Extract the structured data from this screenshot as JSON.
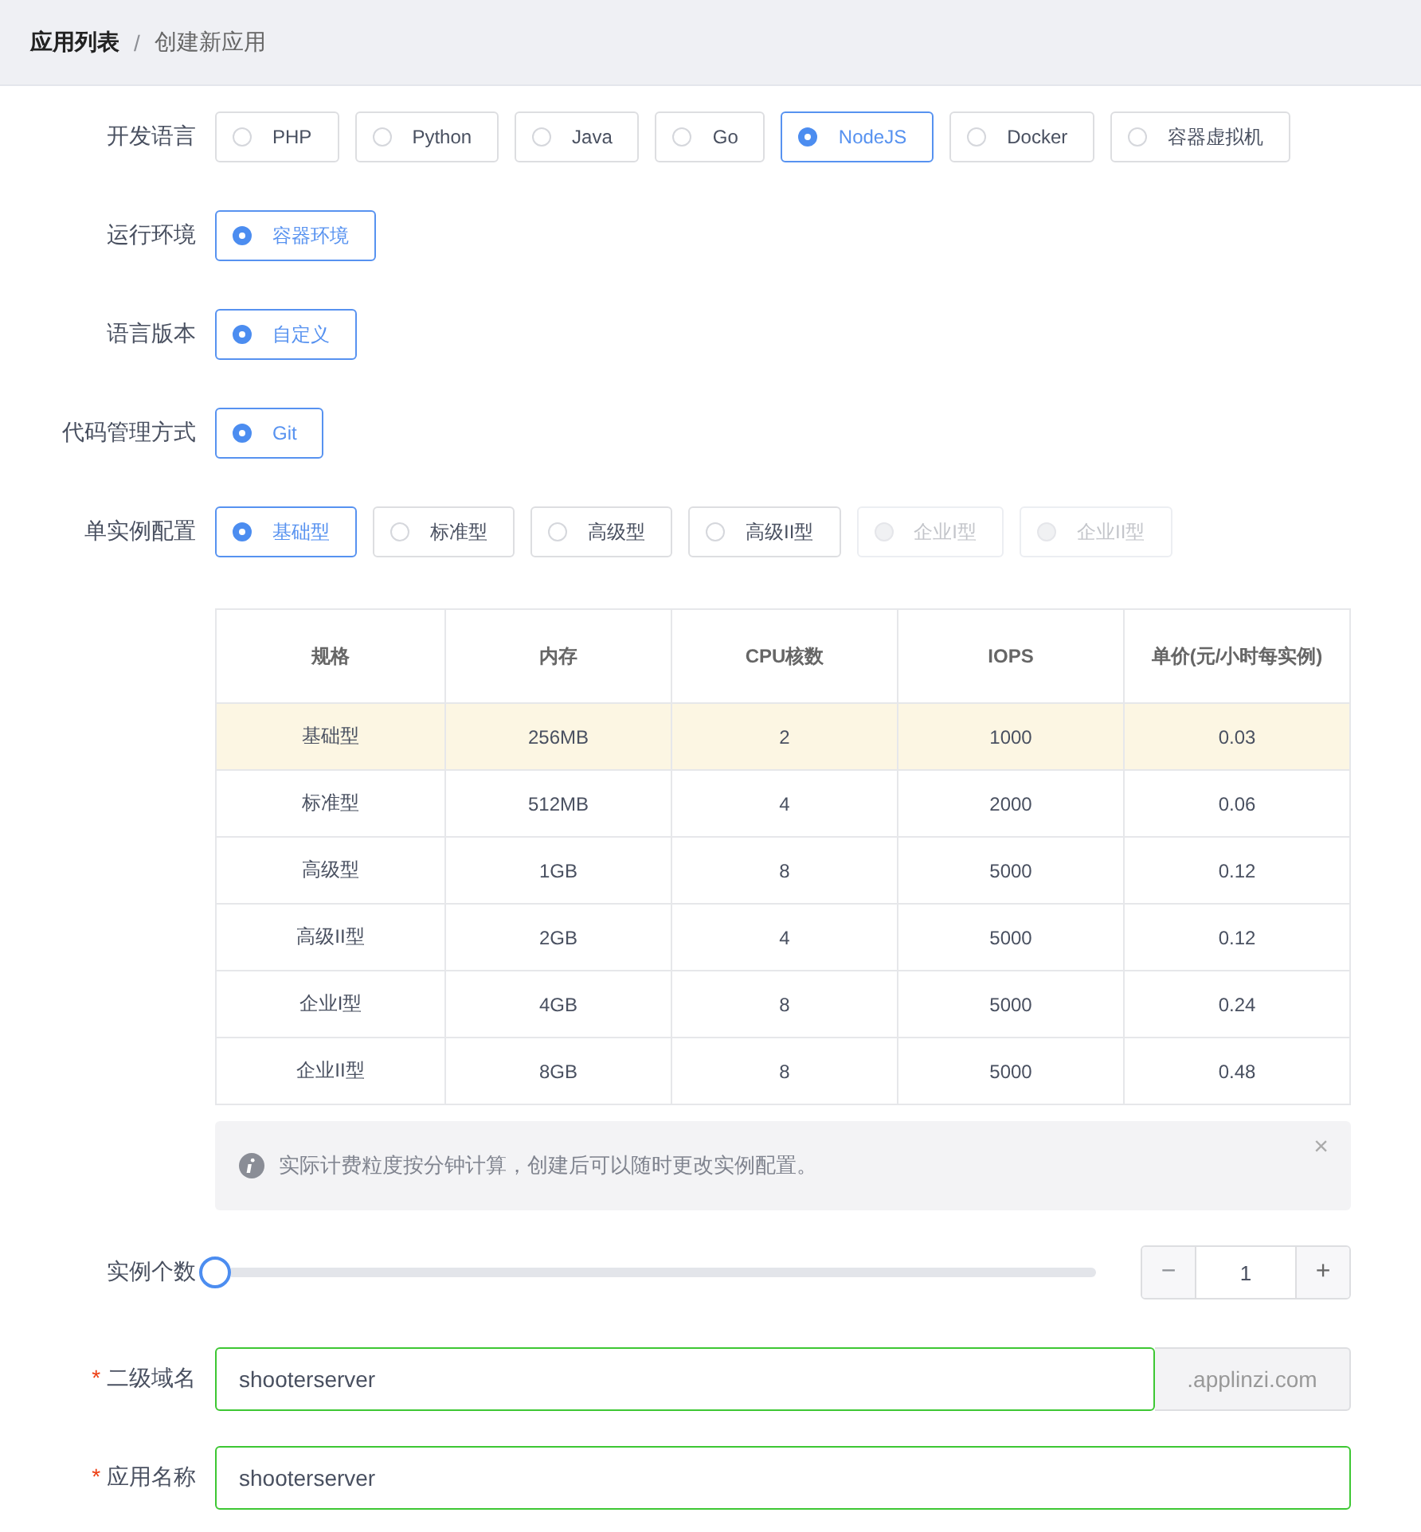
{
  "breadcrumb": [
    {
      "label": "应用列表",
      "current": false
    },
    {
      "label": "创建新应用",
      "current": true
    }
  ],
  "breadcrumb_separator": "/",
  "radio_groups": [
    {
      "label": "开发语言",
      "options": [
        {
          "label": "PHP",
          "selected": false,
          "disabled": false
        },
        {
          "label": "Python",
          "selected": false,
          "disabled": false
        },
        {
          "label": "Java",
          "selected": false,
          "disabled": false
        },
        {
          "label": "Go",
          "selected": false,
          "disabled": false
        },
        {
          "label": "NodeJS",
          "selected": true,
          "disabled": false
        },
        {
          "label": "Docker",
          "selected": false,
          "disabled": false
        },
        {
          "label": "容器虚拟机",
          "selected": false,
          "disabled": false
        }
      ]
    },
    {
      "label": "运行环境",
      "options": [
        {
          "label": "容器环境",
          "selected": true,
          "disabled": false
        }
      ]
    },
    {
      "label": "语言版本",
      "options": [
        {
          "label": "自定义",
          "selected": true,
          "disabled": false
        }
      ]
    },
    {
      "label": "代码管理方式",
      "options": [
        {
          "label": "Git",
          "selected": true,
          "disabled": false
        }
      ]
    },
    {
      "label": "单实例配置",
      "options": [
        {
          "label": "基础型",
          "selected": true,
          "disabled": false
        },
        {
          "label": "标准型",
          "selected": false,
          "disabled": false
        },
        {
          "label": "高级型",
          "selected": false,
          "disabled": false
        },
        {
          "label": "高级II型",
          "selected": false,
          "disabled": false
        },
        {
          "label": "企业I型",
          "selected": false,
          "disabled": true
        },
        {
          "label": "企业II型",
          "selected": false,
          "disabled": true
        }
      ]
    }
  ],
  "table": {
    "columns": [
      "规格",
      "内存",
      "CPU核数",
      "IOPS",
      "单价(元/小时每实例)"
    ],
    "rows": [
      {
        "cells": [
          "基础型",
          "256MB",
          "2",
          "1000",
          "0.03"
        ],
        "selected": true
      },
      {
        "cells": [
          "标准型",
          "512MB",
          "4",
          "2000",
          "0.06"
        ],
        "selected": false
      },
      {
        "cells": [
          "高级型",
          "1GB",
          "8",
          "5000",
          "0.12"
        ],
        "selected": false
      },
      {
        "cells": [
          "高级II型",
          "2GB",
          "4",
          "5000",
          "0.12"
        ],
        "selected": false
      },
      {
        "cells": [
          "企业I型",
          "4GB",
          "8",
          "5000",
          "0.24"
        ],
        "selected": false
      },
      {
        "cells": [
          "企业II型",
          "8GB",
          "8",
          "5000",
          "0.48"
        ],
        "selected": false
      }
    ]
  },
  "alert": {
    "text": "实际计费粒度按分钟计算，创建后可以随时更改实例配置。",
    "close": "×"
  },
  "instance_count": {
    "label": "实例个数",
    "level": 0,
    "value": "1",
    "minus": "−",
    "plus": "+",
    "minus_disabled": true
  },
  "required_mark": "*",
  "fields": [
    {
      "label": "二级域名",
      "required": true,
      "value": "shooterserver",
      "suffix": ".applinzi.com"
    },
    {
      "label": "应用名称",
      "required": true,
      "value": "shooterserver"
    }
  ]
}
